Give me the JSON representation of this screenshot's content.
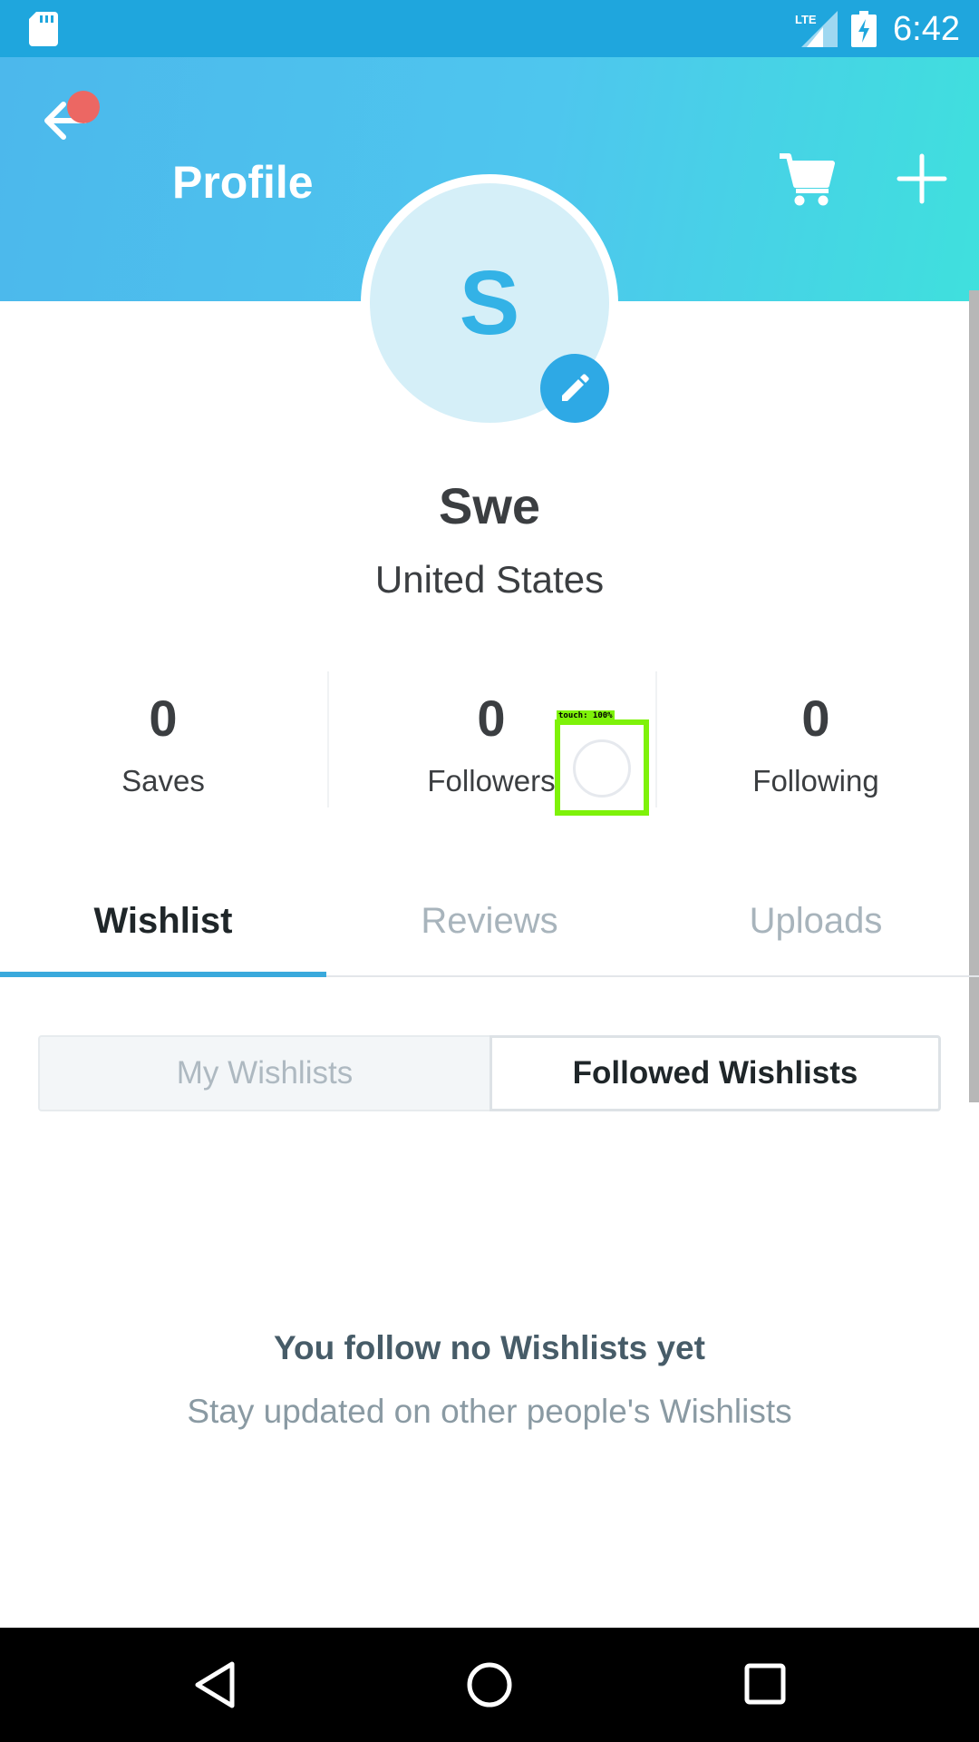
{
  "status_bar": {
    "time": "6:42",
    "network": "LTE",
    "icons": [
      "sd-card-icon",
      "lte-signal-icon",
      "battery-charging-icon"
    ]
  },
  "header": {
    "title": "Profile",
    "back_icon": "back-arrow-icon",
    "cart_icon": "cart-icon",
    "add_icon": "plus-icon",
    "gradient_colors": [
      "#4cb8ec",
      "#3fe0dd"
    ],
    "notification_dot_color": "#ec6763"
  },
  "profile": {
    "avatar_initial": "S",
    "edit_icon": "pencil-icon",
    "name": "Swe",
    "location": "United States"
  },
  "stats": [
    {
      "value": "0",
      "label": "Saves"
    },
    {
      "value": "0",
      "label": "Followers"
    },
    {
      "value": "0",
      "label": "Following"
    }
  ],
  "touch_indicator": {
    "label": "touch: 100%",
    "color": "#7ef209"
  },
  "tabs": [
    {
      "label": "Wishlist",
      "active": true
    },
    {
      "label": "Reviews",
      "active": false
    },
    {
      "label": "Uploads",
      "active": false
    }
  ],
  "wishlist_toggle": {
    "options": [
      "My Wishlists",
      "Followed Wishlists"
    ],
    "selected": "Followed Wishlists"
  },
  "empty_state": {
    "title": "You follow no Wishlists yet",
    "subtitle": "Stay updated on other people's Wishlists"
  },
  "nav_bar": {
    "icons": [
      "nav-back-icon",
      "nav-home-icon",
      "nav-recents-icon"
    ]
  },
  "colors": {
    "status_bar": "#1fa6dd",
    "accent": "#3aa9dc",
    "avatar_bg": "#d5eff8",
    "avatar_letter": "#33b2e6"
  }
}
